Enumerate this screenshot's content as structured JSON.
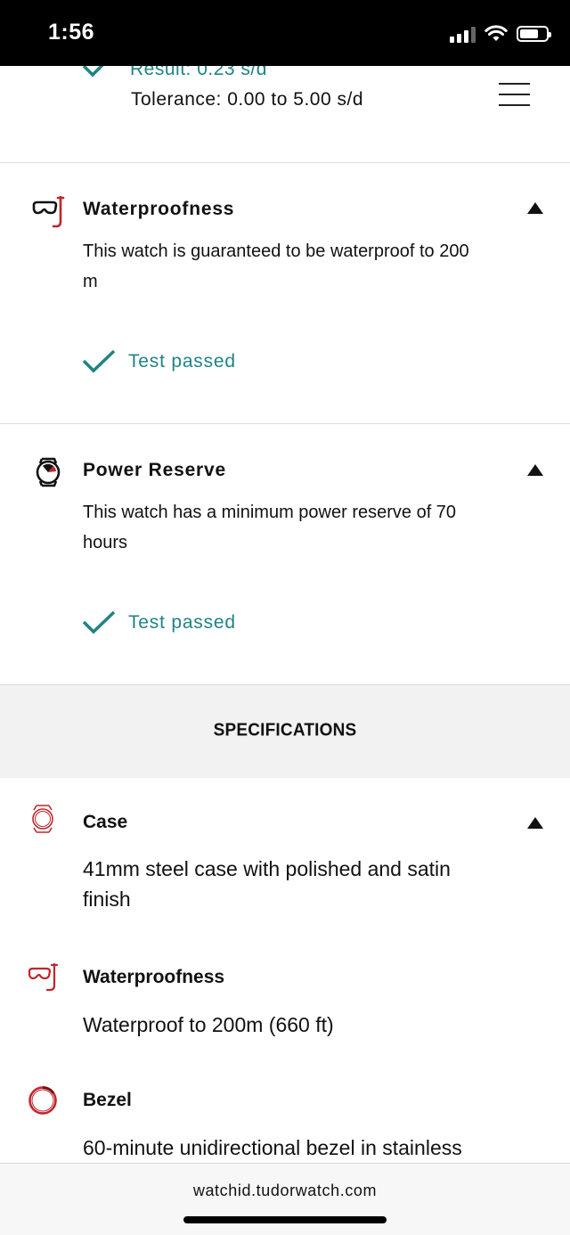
{
  "status_bar": {
    "time": "1:56"
  },
  "top_section": {
    "result": "Result: 0.23 s/d",
    "tolerance": "Tolerance: 0.00 to 5.00 s/d"
  },
  "tests": [
    {
      "title": "Waterproofness",
      "description": "This watch is guaranteed to be waterproof to 200 m",
      "status": "Test passed"
    },
    {
      "title": "Power Reserve",
      "description": "This watch has a minimum power reserve of 70 hours",
      "status": "Test passed"
    }
  ],
  "specifications": {
    "heading": "SPECIFICATIONS",
    "items": [
      {
        "name": "Case",
        "value": "41mm steel case with polished and satin finish"
      },
      {
        "name": "Waterproofness",
        "value": "Waterproof to 200m (660 ft)"
      },
      {
        "name": "Bezel",
        "value": "60-minute unidirectional bezel in stainless"
      }
    ]
  },
  "browser": {
    "url": "watchid.tudorwatch.com"
  },
  "colors": {
    "accent": "#1f8383",
    "icon_red": "#c0262b"
  }
}
